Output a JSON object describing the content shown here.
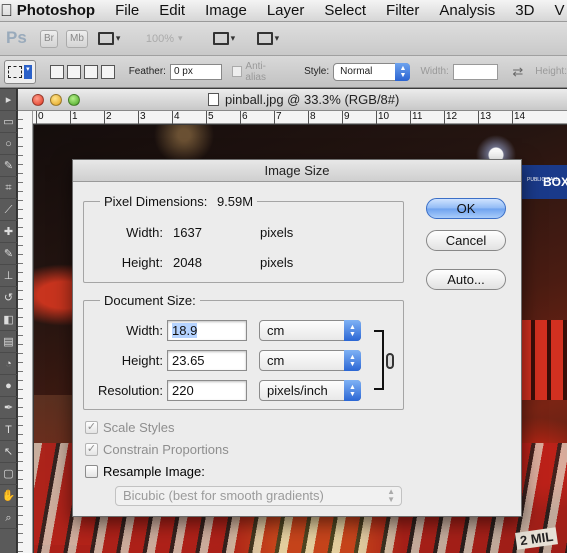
{
  "menubar": {
    "apple_icon": "apple-icon",
    "items": [
      "Photoshop",
      "File",
      "Edit",
      "Image",
      "Layer",
      "Select",
      "Filter",
      "Analysis",
      "3D",
      "V"
    ]
  },
  "appbar": {
    "logo": "Ps",
    "bridge_label": "Br",
    "minibridge_label": "Mb",
    "zoom": "100%"
  },
  "options": {
    "feather_label": "Feather:",
    "feather_value": "0 px",
    "antialias_label": "Anti-alias",
    "style_label": "Style:",
    "style_value": "Normal",
    "width_label": "Width:",
    "height_label": "Height:"
  },
  "document": {
    "title": "pinball.jpg @ 33.3% (RGB/8#)",
    "ruler_labels": [
      "0",
      "1",
      "2",
      "3",
      "4",
      "5",
      "6",
      "7",
      "8",
      "9",
      "10",
      "11",
      "12",
      "13",
      "14"
    ],
    "canvas_sign": "BOX",
    "canvas_sign_small": "PUBLIC CALL",
    "canvas_text": "2 MIL"
  },
  "dialog": {
    "title": "Image Size",
    "pixel_dimensions": {
      "label": "Pixel Dimensions:",
      "size": "9.59M",
      "width_label": "Width:",
      "width_value": "1637",
      "width_unit": "pixels",
      "height_label": "Height:",
      "height_value": "2048",
      "height_unit": "pixels"
    },
    "document_size": {
      "label": "Document Size:",
      "width_label": "Width:",
      "width_value": "18.9",
      "width_unit": "cm",
      "height_label": "Height:",
      "height_value": "23.65",
      "height_unit": "cm",
      "resolution_label": "Resolution:",
      "resolution_value": "220",
      "resolution_unit": "pixels/inch"
    },
    "checkboxes": {
      "scale_styles": "Scale Styles",
      "constrain_proportions": "Constrain Proportions",
      "resample_image": "Resample Image:"
    },
    "resample_method": "Bicubic (best for smooth gradients)",
    "buttons": {
      "ok": "OK",
      "cancel": "Cancel",
      "auto": "Auto..."
    }
  }
}
